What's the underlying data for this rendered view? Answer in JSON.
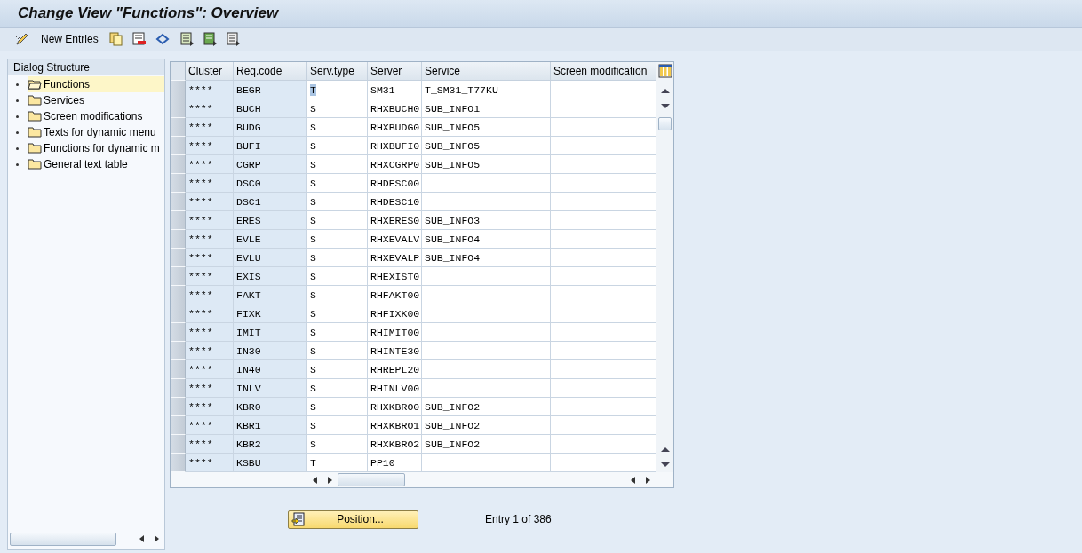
{
  "window": {
    "title": "Change View \"Functions\": Overview"
  },
  "toolbar": {
    "new_entries": "New Entries"
  },
  "dialog_structure": {
    "title": "Dialog Structure",
    "items": [
      {
        "label": "Functions",
        "selected": true
      },
      {
        "label": "Services",
        "selected": false
      },
      {
        "label": "Screen modifications",
        "selected": false
      },
      {
        "label": "Texts for dynamic menu",
        "selected": false
      },
      {
        "label": "Functions for dynamic m",
        "selected": false
      },
      {
        "label": "General text table",
        "selected": false
      }
    ]
  },
  "table": {
    "columns": [
      "Cluster",
      "Req.code",
      "Serv.type",
      "Server",
      "Service",
      "Screen modification"
    ],
    "rows": [
      {
        "cells": [
          "****",
          "BEGR",
          "T",
          "SM31",
          "T_SM31_T77KU",
          ""
        ],
        "highlighted": true
      },
      {
        "cells": [
          "****",
          "BUCH",
          "S",
          "RHXBUCH0",
          "SUB_INFO1",
          ""
        ],
        "highlighted": false
      },
      {
        "cells": [
          "****",
          "BUDG",
          "S",
          "RHXBUDG0",
          "SUB_INFO5",
          ""
        ],
        "highlighted": false
      },
      {
        "cells": [
          "****",
          "BUFI",
          "S",
          "RHXBUFI0",
          "SUB_INFO5",
          ""
        ],
        "highlighted": false
      },
      {
        "cells": [
          "****",
          "CGRP",
          "S",
          "RHXCGRP0",
          "SUB_INFO5",
          ""
        ],
        "highlighted": false
      },
      {
        "cells": [
          "****",
          "DSC0",
          "S",
          "RHDESC00",
          "",
          ""
        ],
        "highlighted": false
      },
      {
        "cells": [
          "****",
          "DSC1",
          "S",
          "RHDESC10",
          "",
          ""
        ],
        "highlighted": false
      },
      {
        "cells": [
          "****",
          "ERES",
          "S",
          "RHXERES0",
          "SUB_INFO3",
          ""
        ],
        "highlighted": false
      },
      {
        "cells": [
          "****",
          "EVLE",
          "S",
          "RHXEVALV",
          "SUB_INFO4",
          ""
        ],
        "highlighted": false
      },
      {
        "cells": [
          "****",
          "EVLU",
          "S",
          "RHXEVALP",
          "SUB_INFO4",
          ""
        ],
        "highlighted": false
      },
      {
        "cells": [
          "****",
          "EXIS",
          "S",
          "RHEXIST0",
          "",
          ""
        ],
        "highlighted": false
      },
      {
        "cells": [
          "****",
          "FAKT",
          "S",
          "RHFAKT00",
          "",
          ""
        ],
        "highlighted": false
      },
      {
        "cells": [
          "****",
          "FIXK",
          "S",
          "RHFIXK00",
          "",
          ""
        ],
        "highlighted": false
      },
      {
        "cells": [
          "****",
          "IMIT",
          "S",
          "RHIMIT00",
          "",
          ""
        ],
        "highlighted": false
      },
      {
        "cells": [
          "****",
          "IN30",
          "S",
          "RHINTE30",
          "",
          ""
        ],
        "highlighted": false
      },
      {
        "cells": [
          "****",
          "IN40",
          "S",
          "RHREPL20",
          "",
          ""
        ],
        "highlighted": false
      },
      {
        "cells": [
          "****",
          "INLV",
          "S",
          "RHINLV00",
          "",
          ""
        ],
        "highlighted": false
      },
      {
        "cells": [
          "****",
          "KBR0",
          "S",
          "RHXKBRO0",
          "SUB_INFO2",
          ""
        ],
        "highlighted": false
      },
      {
        "cells": [
          "****",
          "KBR1",
          "S",
          "RHXKBRO1",
          "SUB_INFO2",
          ""
        ],
        "highlighted": false
      },
      {
        "cells": [
          "****",
          "KBR2",
          "S",
          "RHXKBRO2",
          "SUB_INFO2",
          ""
        ],
        "highlighted": false
      },
      {
        "cells": [
          "****",
          "KSBU",
          "T",
          "PP10",
          "",
          ""
        ],
        "highlighted": false
      }
    ]
  },
  "footer": {
    "position_button": "Position...",
    "entry_info": "Entry 1 of 386"
  }
}
